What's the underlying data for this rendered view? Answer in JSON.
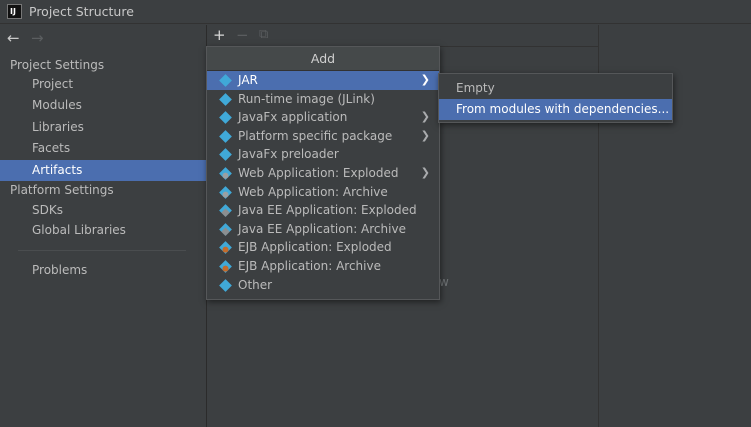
{
  "window": {
    "title": "Project Structure",
    "logo_text": "IJ"
  },
  "nav": {
    "back_icon": "←",
    "forward_icon": "→"
  },
  "sidebar": {
    "project_settings_header": "Project Settings",
    "project_settings_items": [
      {
        "label": "Project"
      },
      {
        "label": "Modules"
      },
      {
        "label": "Libraries"
      },
      {
        "label": "Facets"
      },
      {
        "label": "Artifacts",
        "selected": true
      }
    ],
    "platform_settings_header": "Platform Settings",
    "platform_settings_items": [
      {
        "label": "SDKs"
      },
      {
        "label": "Global Libraries"
      }
    ],
    "problems_label": "Problems"
  },
  "toolbar": {
    "add_icon": "+",
    "remove_icon": "−",
    "copy_icon": "⧉"
  },
  "main": {
    "hint_fragment": "w"
  },
  "add_menu": {
    "title": "Add",
    "items": [
      {
        "label": "JAR",
        "icon": "jar-icon",
        "submenu": true,
        "selected": true
      },
      {
        "label": "Run-time image (JLink)",
        "icon": "runtime-image-icon",
        "submenu": false
      },
      {
        "label": "JavaFx application",
        "icon": "javafx-icon",
        "submenu": true
      },
      {
        "label": "Platform specific package",
        "icon": "package-icon",
        "submenu": true
      },
      {
        "label": "JavaFx preloader",
        "icon": "javafx-icon",
        "submenu": false
      },
      {
        "label": "Web Application: Exploded",
        "icon": "web-app-icon",
        "submenu": true
      },
      {
        "label": "Web Application: Archive",
        "icon": "web-app-icon",
        "submenu": false
      },
      {
        "label": "Java EE Application: Exploded",
        "icon": "javaee-icon",
        "submenu": false
      },
      {
        "label": "Java EE Application: Archive",
        "icon": "javaee-icon",
        "submenu": false
      },
      {
        "label": "EJB Application: Exploded",
        "icon": "ejb-icon",
        "submenu": false
      },
      {
        "label": "EJB Application: Archive",
        "icon": "ejb-icon",
        "submenu": false
      },
      {
        "label": "Other",
        "icon": "artifact-icon",
        "submenu": false
      }
    ],
    "submenu_arrow": "❯"
  },
  "jar_submenu": {
    "items": [
      {
        "label": "Empty"
      },
      {
        "label": "From modules with dependencies...",
        "selected": true
      }
    ]
  },
  "colors": {
    "background": "#3c3f41",
    "selection": "#4b6eaf",
    "text": "#bbbbbb",
    "icon_accent": "#40a9d8"
  }
}
